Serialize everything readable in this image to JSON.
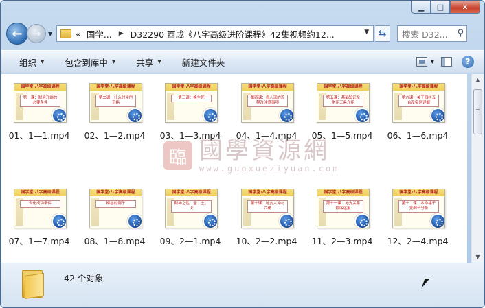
{
  "address": {
    "crumbs": [
      "«",
      "国学...",
      "D32290 酉成《八字高级进阶课程》42集视频约12..."
    ],
    "search_placeholder": "搜索 D32..."
  },
  "toolbar": {
    "organize": "组织",
    "include_in_library": "包含到库中",
    "share": "共享",
    "new_folder": "新建文件夹"
  },
  "thumb_header": "国学堂·八字高级课程",
  "files": [
    {
      "name": "01、1—1.mp4",
      "caption": "第一课：财运开端的必要条件"
    },
    {
      "name": "02、1—2.mp4",
      "caption": "第二课：什么时候甩正格"
    },
    {
      "name": "03、1—3.mp4",
      "caption": "第三课：换生死"
    },
    {
      "name": "04、1—4.mp4",
      "caption": "第四课：看人流的流程及注意事项"
    },
    {
      "name": "05、1—5.mp4",
      "caption": "第五课：基础知识及常用工具介绍"
    },
    {
      "name": "06、1—6.mp4",
      "caption": "第六课：关于四柱五合及实例详解"
    },
    {
      "name": "07、1—7.mp4",
      "caption": "合化成功条件"
    },
    {
      "name": "08、1—8.mp4",
      "caption": "柳谷的例子"
    },
    {
      "name": "09、2—1.mp4",
      "caption": "財神之性：金：土；火"
    },
    {
      "name": "10、2—2.mp4",
      "caption": "第十课：地支六冲与六破"
    },
    {
      "name": "11、2—3.mp4",
      "caption": "第十一课：地支关系顺序运用"
    },
    {
      "name": "12、2—4.mp4",
      "caption": "第十二课：本命格干支细节分析"
    }
  ],
  "watermark": {
    "main": "國學資源網",
    "url": "www.guoxueziyuan.com",
    "logo": "臨"
  },
  "details": {
    "count": "42 个对象"
  }
}
